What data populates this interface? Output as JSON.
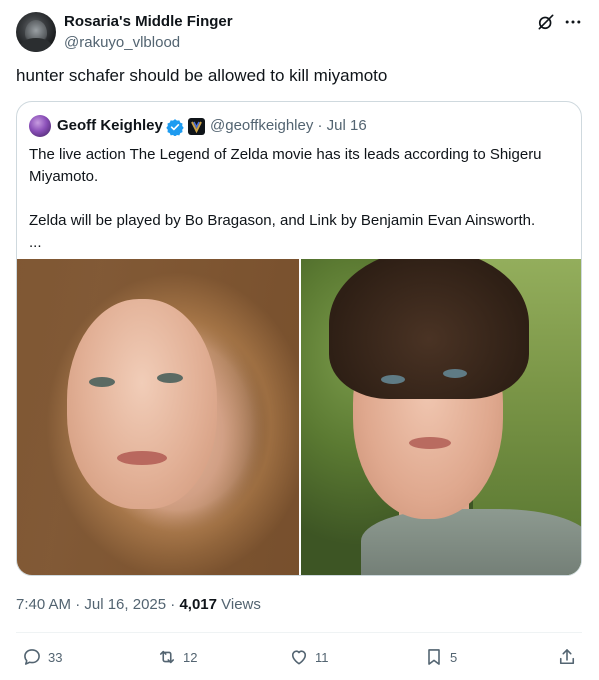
{
  "tweet": {
    "display_name": "Rosaria's Middle Finger",
    "handle": "@rakuyo_vlblood",
    "text": "hunter schafer should be allowed to kill miyamoto"
  },
  "quoted_tweet": {
    "display_name": "Geoff Keighley",
    "handle_and_date": "@geoffkeighley · Jul 16",
    "text": "The live action The Legend of Zelda movie has its leads according to Shigeru Miyamoto.\n\nZelda will be played by Bo Bragason, and Link by Benjamin Evan Ainsworth.\n..."
  },
  "meta": {
    "time_date": "7:40 AM · Jul 16, 2025 · ",
    "views_count": "4,017",
    "views_label": " Views"
  },
  "actions": {
    "replies": "33",
    "reposts": "12",
    "likes": "11",
    "bookmarks": "5"
  },
  "colors": {
    "text_primary": "#0f1419",
    "text_secondary": "#536471",
    "border": "#cfd9de",
    "verified": "#1d9bf0"
  },
  "icons": {
    "grok": "grok-icon",
    "more": "more-icon",
    "verified": "verified-icon",
    "reply": "reply-icon",
    "repost": "repost-icon",
    "like": "heart-icon",
    "bookmark": "bookmark-icon",
    "share": "share-icon"
  }
}
